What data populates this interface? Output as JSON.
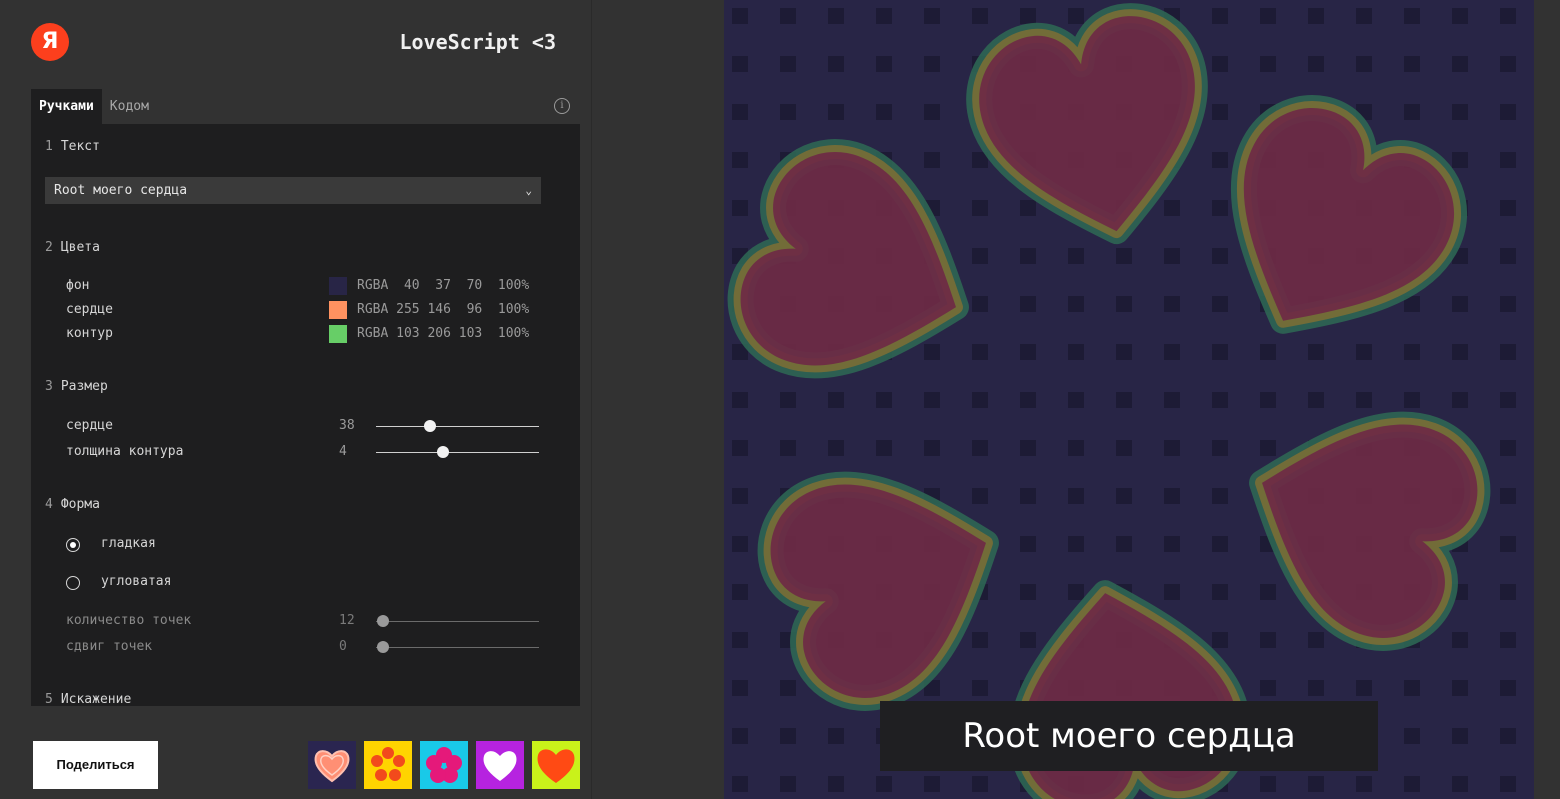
{
  "header": {
    "logo_letter": "Я",
    "title": "LoveScript <3"
  },
  "tabs": [
    {
      "label": "Ручками",
      "active": true
    },
    {
      "label": "Кодом",
      "active": false
    }
  ],
  "info_icon": "info-icon",
  "sections": {
    "text": {
      "num": "1",
      "title": "Текст",
      "selected": "Root моего сердца"
    },
    "colors": {
      "num": "2",
      "title": "Цвета",
      "rows": [
        {
          "label": "фон",
          "rgba": "RGBA  40  37  70  100%",
          "hex": "#282546"
        },
        {
          "label": "сердце",
          "rgba": "RGBA 255 146  96  100%",
          "hex": "#ff9260"
        },
        {
          "label": "контур",
          "rgba": "RGBA 103 206 103  100%",
          "hex": "#67ce67"
        }
      ]
    },
    "size": {
      "num": "3",
      "title": "Размер",
      "rows": [
        {
          "label": "сердце",
          "value": "38",
          "fraction": 0.33
        },
        {
          "label": "толщина контура",
          "value": "4",
          "fraction": 0.41
        }
      ]
    },
    "shape": {
      "num": "4",
      "title": "Форма",
      "options": [
        {
          "label": "гладкая",
          "checked": true
        },
        {
          "label": "угловатая",
          "checked": false
        }
      ],
      "sub": [
        {
          "label": "количество точек",
          "value": "12",
          "fraction": 0.04
        },
        {
          "label": "сдвиг точек",
          "value": "0",
          "fraction": 0.04
        }
      ]
    },
    "distortion": {
      "num": "5",
      "title": "Искажение"
    }
  },
  "share_label": "Поделиться",
  "presets": [
    "preset-pink-heart",
    "preset-yellow-petals",
    "preset-cyan-flower",
    "preset-purple-heart",
    "preset-orange-heart"
  ],
  "canvas": {
    "caption": "Root моего сердца",
    "background": "#282546",
    "heart_fill": "#6e2a45",
    "outline_inner": "#7a6e35",
    "outline_outer": "#2e6a55"
  }
}
